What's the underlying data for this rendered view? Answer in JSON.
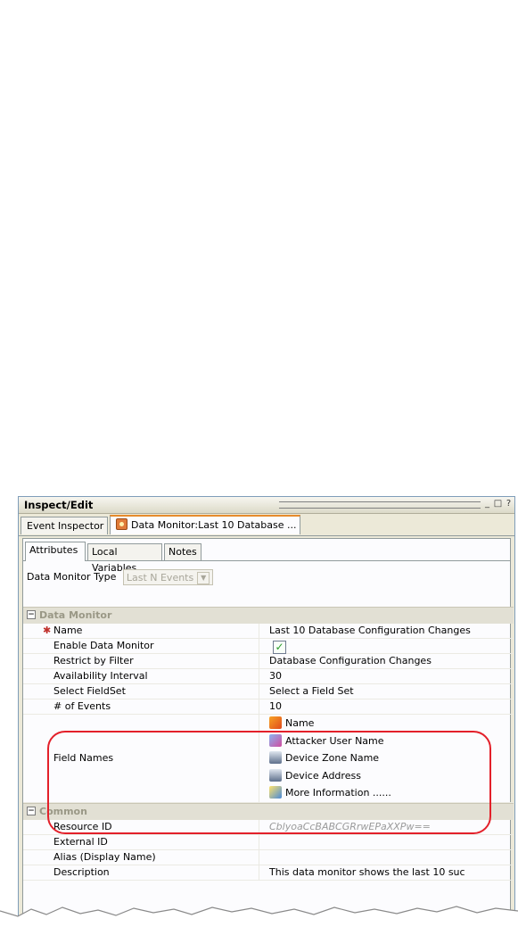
{
  "window": {
    "title": "Inspect/Edit",
    "controls": [
      "_",
      "□",
      "?"
    ]
  },
  "doc_tabs": [
    {
      "label": "Event Inspector",
      "active": false
    },
    {
      "label": "Data Monitor:Last 10 Database ...",
      "active": true
    }
  ],
  "sub_tabs": [
    {
      "label": "Attributes",
      "active": true
    },
    {
      "label": "Local Variables",
      "active": false
    },
    {
      "label": "Notes",
      "active": false
    }
  ],
  "type_row": {
    "label": "Data Monitor Type",
    "value": "Last N Events"
  },
  "sections": {
    "data_monitor": {
      "title": "Data Monitor",
      "rows": [
        {
          "label": "Name",
          "value": "Last 10 Database Configuration Changes",
          "required": true
        },
        {
          "label": "Enable Data Monitor",
          "value": "",
          "checkbox": true
        },
        {
          "label": "Restrict by Filter",
          "value": "Database Configuration Changes"
        },
        {
          "label": "Availability Interval",
          "value": "30"
        },
        {
          "label": "Select FieldSet",
          "value": "Select a Field Set"
        },
        {
          "label": "# of Events",
          "value": "10"
        }
      ],
      "field_names": {
        "label": "Field Names",
        "items": [
          {
            "text": "Name",
            "icon": "event-name-icon"
          },
          {
            "text": "Attacker User Name",
            "icon": "user-name-icon"
          },
          {
            "text": "Device Zone Name",
            "icon": "device-icon"
          },
          {
            "text": "Device Address",
            "icon": "device-icon"
          },
          {
            "text": "More Information ......",
            "icon": "info-icon"
          }
        ]
      }
    },
    "common": {
      "title": "Common",
      "rows": [
        {
          "label": "Resource ID",
          "value": "CblyoaCcBABCGRrwEPaXXPw==",
          "muted": true
        },
        {
          "label": "External ID",
          "value": ""
        },
        {
          "label": "Alias (Display Name)",
          "value": ""
        },
        {
          "label": "Description",
          "value": "This data monitor shows the last 10 suc"
        }
      ]
    }
  },
  "colors": {
    "highlight": "#e3202a",
    "active_tab_accent": "#e68b2c",
    "panel_bg": "#ece9d8"
  }
}
